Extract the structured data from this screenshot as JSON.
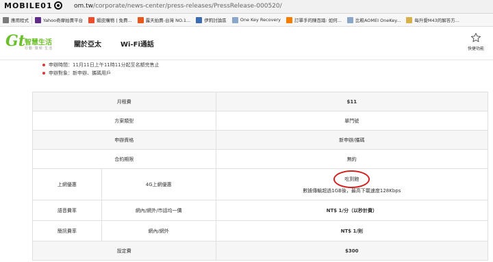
{
  "browser": {
    "watermark": "MOBILE01",
    "url_prefix": "om.tw",
    "url_path": "/corporate/news-center/press-releases/PressRelease-000520/"
  },
  "bookmarks": [
    {
      "label": "應用程式",
      "icon": "apps-icon",
      "color": "#7a7a7a"
    },
    {
      "label": "Yahoo奇摩拍賣平台",
      "icon": "yahoo-icon",
      "color": "#5f2b8a"
    },
    {
      "label": "蝦皮購物 | 免費...",
      "icon": "shopee-icon",
      "color": "#ee4d2d"
    },
    {
      "label": "露天拍賣-台灣 NO.1...",
      "icon": "ruten-icon",
      "color": "#e8581c"
    },
    {
      "label": "伊莉討論區",
      "icon": "eyny-icon",
      "color": "#3b6bb0"
    },
    {
      "label": "One Key Recovery",
      "icon": "doc-icon",
      "color": "#8aa6c9"
    },
    {
      "label": "訂單手的陳百踏: 如何...",
      "icon": "blogger-icon",
      "color": "#f57d00"
    },
    {
      "label": "比較AOMEI OneKey...",
      "icon": "doc-icon",
      "color": "#8aa6c9"
    },
    {
      "label": "每升愛M43的解答方...",
      "icon": "folder-icon",
      "color": "#d8b04a"
    }
  ],
  "header": {
    "logo_mark": "Gt",
    "logo_name": "智慧生活",
    "logo_sub": "行動‧寬頻‧生活",
    "nav": [
      "關於亞太",
      "Wi-Fi通話"
    ],
    "quick_label": "快捷功能"
  },
  "bullets": [
    "申辦時間：11月11日上午11時11分起至名額完售止",
    "申辦對象：新申辦、攜碼用戶"
  ],
  "table": {
    "monthly_fee_label": "月租費",
    "monthly_fee_value": "$11",
    "plan_type_label": "方案類型",
    "plan_type_value": "單門號",
    "eligibility_label": "申辦資格",
    "eligibility_value": "新申辦/攜碼",
    "contract_label": "合約期限",
    "contract_value": "無約",
    "internet_label": "上網優惠",
    "internet_sub_label": "4G上網優惠",
    "internet_value_main": "吃到飽",
    "internet_value_note": "數據傳輸超過1GB後，最高下載速度128Kbps",
    "voice_label": "語音費率",
    "voice_sub_label": "網內/網外/市話均一價",
    "voice_value": "NT$ 1/分（以秒計費）",
    "sms_label": "簡訊費率",
    "sms_sub_label": "網內/網外",
    "sms_value": "NT$ 1/則",
    "setup_label": "設定費",
    "setup_value": "$300"
  },
  "colors": {
    "brand_green": "#6bbf2a",
    "annotation_red": "#d21f1f",
    "bullet_red": "#d9393c"
  }
}
